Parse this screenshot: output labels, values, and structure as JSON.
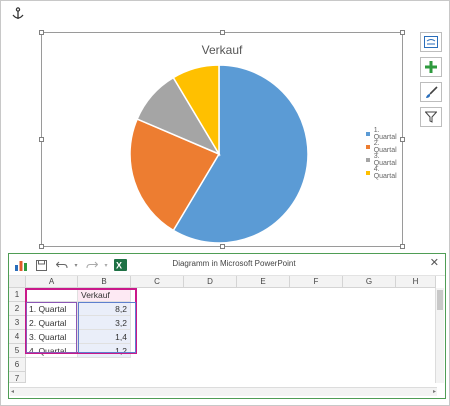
{
  "icons": {
    "anchor": "anchor-icon",
    "chart_elements": "chart-elements-icon",
    "add": "plus-icon",
    "style": "paintbrush-icon",
    "filter": "filter-icon",
    "chart_tool": "chart-icon",
    "save": "save-icon",
    "undo": "undo-icon",
    "redo": "redo-icon",
    "excel": "excel-icon",
    "close": "close-icon"
  },
  "chart": {
    "title": "Verkauf"
  },
  "chart_data": {
    "type": "pie",
    "title": "Verkauf",
    "categories": [
      "1. Quartal",
      "2. Quartal",
      "3. Quartal",
      "4. Quartal"
    ],
    "values": [
      8.2,
      3.2,
      1.4,
      1.2
    ],
    "colors": [
      "#5b9bd5",
      "#ed7d31",
      "#a5a5a5",
      "#ffc000"
    ],
    "legend": "right"
  },
  "sheet": {
    "title": "Diagramm in Microsoft PowerPoint",
    "close_label": "✕",
    "columns": [
      "A",
      "B",
      "C",
      "D",
      "E",
      "F",
      "G",
      "H"
    ],
    "rows": [
      "1",
      "2",
      "3",
      "4",
      "5",
      "6",
      "7"
    ],
    "header_b": "Verkauf",
    "cells": [
      {
        "a": "1. Quartal",
        "b": "8,2"
      },
      {
        "a": "2. Quartal",
        "b": "3,2"
      },
      {
        "a": "3. Quartal",
        "b": "1,4"
      },
      {
        "a": "4. Quartal",
        "b": "1,2"
      }
    ]
  }
}
